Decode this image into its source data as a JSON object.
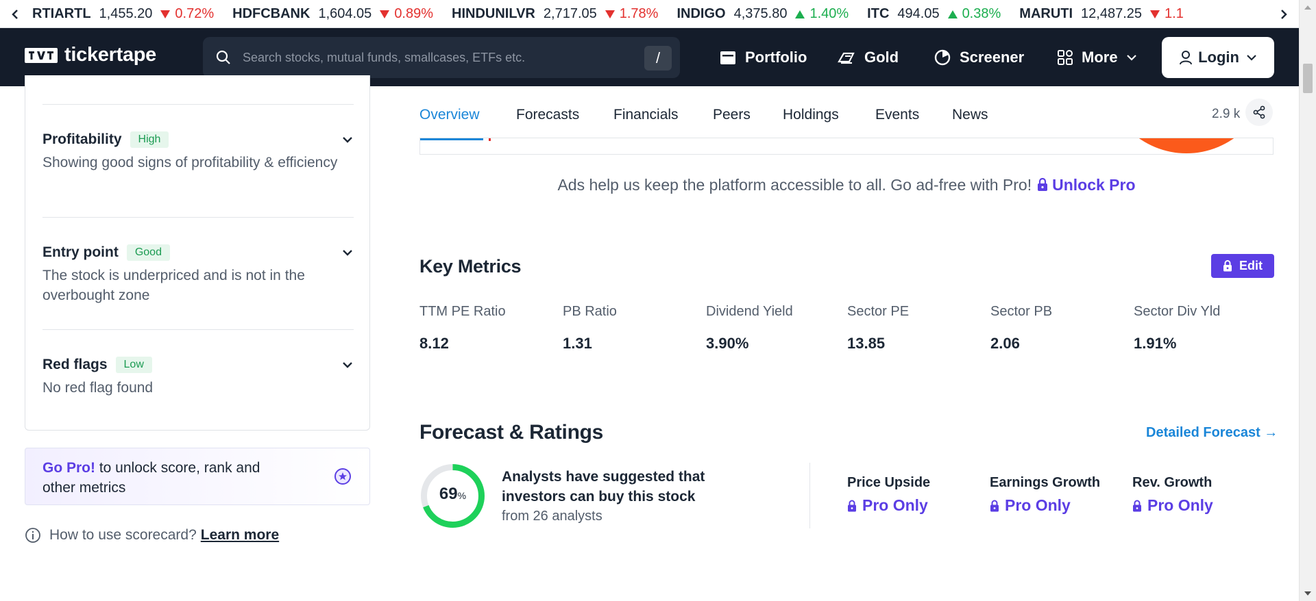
{
  "ticker": {
    "items": [
      {
        "symbol": "RTIARTL",
        "price": "1,455.20",
        "change": "0.72%",
        "direction": "down"
      },
      {
        "symbol": "HDFCBANK",
        "price": "1,604.05",
        "change": "0.89%",
        "direction": "down"
      },
      {
        "symbol": "HINDUNILVR",
        "price": "2,717.05",
        "change": "1.78%",
        "direction": "down"
      },
      {
        "symbol": "INDIGO",
        "price": "4,375.80",
        "change": "1.40%",
        "direction": "up"
      },
      {
        "symbol": "ITC",
        "price": "494.05",
        "change": "0.38%",
        "direction": "up"
      },
      {
        "symbol": "MARUTI",
        "price": "12,487.25",
        "change": "1.1",
        "direction": "down"
      }
    ]
  },
  "header": {
    "brand": "tickertape",
    "search_placeholder": "Search stocks, mutual funds, smallcases, ETFs etc.",
    "search_shortcut": "/",
    "nav": {
      "portfolio": "Portfolio",
      "gold": "Gold",
      "screener": "Screener",
      "more": "More",
      "login": "Login"
    }
  },
  "scorecard": {
    "items": [
      {
        "title": "Profitability",
        "badge": "High",
        "description": "Showing good signs of profitability & efficiency"
      },
      {
        "title": "Entry point",
        "badge": "Good",
        "description": "The stock is underpriced and is not in the overbought zone"
      },
      {
        "title": "Red flags",
        "badge": "Low",
        "description": "No red flag found"
      }
    ],
    "gopro": {
      "link": "Go Pro!",
      "text": " to unlock score, rank and other metrics"
    },
    "howto": {
      "text": "How to use scorecard?",
      "link": "Learn more"
    }
  },
  "tabs": {
    "items": [
      "Overview",
      "Forecasts",
      "Financials",
      "Peers",
      "Holdings",
      "Events",
      "News"
    ],
    "active": "Overview",
    "view_count": "2.9 k"
  },
  "ads": {
    "note": "Ads help us keep the platform accessible to all. Go ad-free with Pro!",
    "unlock": "Unlock Pro"
  },
  "key_metrics": {
    "title": "Key Metrics",
    "edit": "Edit",
    "metrics": [
      {
        "label": "TTM PE Ratio",
        "value": "8.12"
      },
      {
        "label": "PB Ratio",
        "value": "1.31"
      },
      {
        "label": "Dividend Yield",
        "value": "3.90%"
      },
      {
        "label": "Sector PE",
        "value": "13.85"
      },
      {
        "label": "Sector PB",
        "value": "2.06"
      },
      {
        "label": "Sector Div Yld",
        "value": "1.91%"
      }
    ]
  },
  "forecast": {
    "title": "Forecast & Ratings",
    "link": "Detailed Forecast →",
    "buy_percent": 69,
    "buy_percent_label": "69",
    "percent_sign": "%",
    "analyst_text": "Analysts have suggested that investors can buy this stock",
    "analyst_sub": "from 26 analysts",
    "metrics": [
      {
        "label": "Price Upside",
        "value": "Pro Only"
      },
      {
        "label": "Earnings Growth",
        "value": "Pro Only"
      },
      {
        "label": "Rev. Growth",
        "value": "Pro Only"
      }
    ]
  },
  "colors": {
    "header_bg": "#141c2a",
    "accent_purple": "#5b3ee4",
    "accent_blue": "#1a86d8",
    "positive": "#1cae4f",
    "negative": "#e3312f"
  }
}
